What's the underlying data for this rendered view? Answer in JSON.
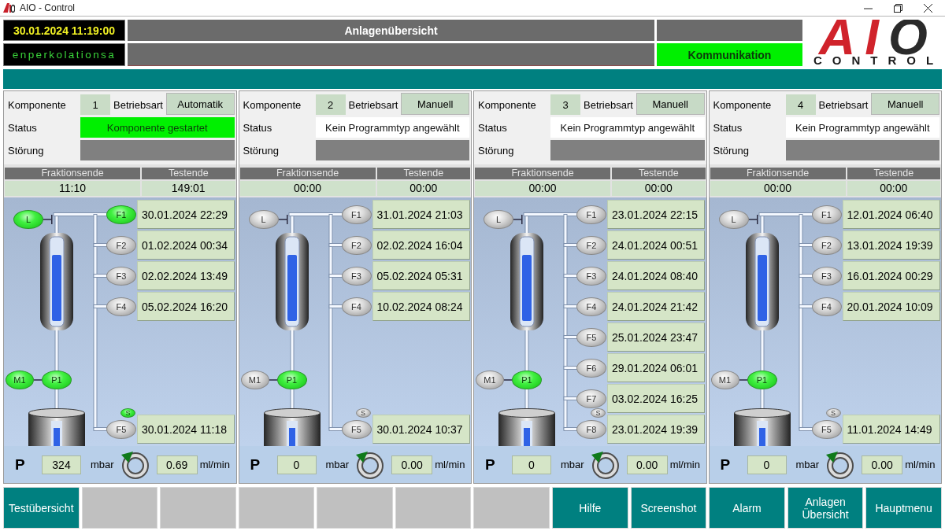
{
  "window": {
    "title": "AIO - Control"
  },
  "header": {
    "datetime": "30.01.2024 11:19:00",
    "title": "Anlagenübersicht",
    "ticker": "enperkolationsa",
    "communication": {
      "label": "Kommunikation",
      "ok": true
    },
    "logo": {
      "mark": "AIO",
      "wordmark": "CONTROL"
    }
  },
  "panels": [
    {
      "component": {
        "label": "Komponente",
        "value": "1"
      },
      "mode": {
        "label": "Betriebsart",
        "value": "Automatik"
      },
      "status": {
        "label": "Status",
        "value": "Komponente gestartet",
        "kind": "running"
      },
      "fault": {
        "label": "Störung",
        "active": false
      },
      "times": [
        {
          "label": "Fraktionsende",
          "value": "11:10"
        },
        {
          "label": "Testende",
          "value": "149:01"
        }
      ],
      "diagram": {
        "inlet": {
          "label": "L",
          "on": true
        },
        "fractions": [
          {
            "label": "F1",
            "date": "30.01.2024 22:29",
            "on": true
          },
          {
            "label": "F2",
            "date": "01.02.2024 00:34",
            "on": false
          },
          {
            "label": "F3",
            "date": "02.02.2024 13:49",
            "on": false
          },
          {
            "label": "F4",
            "date": "05.02.2024 16:20",
            "on": false
          }
        ],
        "outlet": {
          "label": "F5",
          "date": "30.01.2024 11:18",
          "on": false
        },
        "sensor": {
          "label": "S",
          "on": true
        },
        "mixer": {
          "label": "M1",
          "on": true
        },
        "pump": {
          "label": "P1",
          "on": true
        }
      },
      "readings": {
        "pressure": {
          "label": "P",
          "value": "324",
          "unit": "mbar"
        },
        "flow": {
          "value": "0.69",
          "unit": "ml/min"
        }
      }
    },
    {
      "component": {
        "label": "Komponente",
        "value": "2"
      },
      "mode": {
        "label": "Betriebsart",
        "value": "Manuell"
      },
      "status": {
        "label": "Status",
        "value": "Kein Programmtyp angewählt",
        "kind": "idle"
      },
      "fault": {
        "label": "Störung",
        "active": false
      },
      "times": [
        {
          "label": "Fraktionsende",
          "value": "00:00"
        },
        {
          "label": "Testende",
          "value": "00:00"
        }
      ],
      "diagram": {
        "inlet": {
          "label": "L",
          "on": false
        },
        "fractions": [
          {
            "label": "F1",
            "date": "31.01.2024 21:03",
            "on": false
          },
          {
            "label": "F2",
            "date": "02.02.2024 16:04",
            "on": false
          },
          {
            "label": "F3",
            "date": "05.02.2024 05:31",
            "on": false
          },
          {
            "label": "F4",
            "date": "10.02.2024 08:24",
            "on": false
          }
        ],
        "outlet": {
          "label": "F5",
          "date": "30.01.2024 10:37",
          "on": false
        },
        "sensor": {
          "label": "S",
          "on": false
        },
        "mixer": {
          "label": "M1",
          "on": false
        },
        "pump": {
          "label": "P1",
          "on": true
        }
      },
      "readings": {
        "pressure": {
          "label": "P",
          "value": "0",
          "unit": "mbar"
        },
        "flow": {
          "value": "0.00",
          "unit": "ml/min"
        }
      }
    },
    {
      "component": {
        "label": "Komponente",
        "value": "3"
      },
      "mode": {
        "label": "Betriebsart",
        "value": "Manuell"
      },
      "status": {
        "label": "Status",
        "value": "Kein Programmtyp angewählt",
        "kind": "idle"
      },
      "fault": {
        "label": "Störung",
        "active": false
      },
      "times": [
        {
          "label": "Fraktionsende",
          "value": "00:00"
        },
        {
          "label": "Testende",
          "value": "00:00"
        }
      ],
      "diagram": {
        "inlet": {
          "label": "L",
          "on": false
        },
        "fractions": [
          {
            "label": "F1",
            "date": "23.01.2024 22:15",
            "on": false
          },
          {
            "label": "F2",
            "date": "24.01.2024 00:51",
            "on": false
          },
          {
            "label": "F3",
            "date": "24.01.2024 08:40",
            "on": false
          },
          {
            "label": "F4",
            "date": "24.01.2024 21:42",
            "on": false
          },
          {
            "label": "F5",
            "date": "25.01.2024 23:47",
            "on": false
          },
          {
            "label": "F6",
            "date": "29.01.2024 06:01",
            "on": false
          },
          {
            "label": "F7",
            "date": "03.02.2024 16:25",
            "on": false
          }
        ],
        "outlet": {
          "label": "F8",
          "date": "23.01.2024 19:39",
          "on": false
        },
        "sensor": {
          "label": "S",
          "on": false
        },
        "mixer": {
          "label": "M1",
          "on": false
        },
        "pump": {
          "label": "P1",
          "on": true
        }
      },
      "readings": {
        "pressure": {
          "label": "P",
          "value": "0",
          "unit": "mbar"
        },
        "flow": {
          "value": "0.00",
          "unit": "ml/min"
        }
      }
    },
    {
      "component": {
        "label": "Komponente",
        "value": "4"
      },
      "mode": {
        "label": "Betriebsart",
        "value": "Manuell"
      },
      "status": {
        "label": "Status",
        "value": "Kein Programmtyp angewählt",
        "kind": "idle"
      },
      "fault": {
        "label": "Störung",
        "active": false
      },
      "times": [
        {
          "label": "Fraktionsende",
          "value": "00:00"
        },
        {
          "label": "Testende",
          "value": "00:00"
        }
      ],
      "diagram": {
        "inlet": {
          "label": "L",
          "on": false
        },
        "fractions": [
          {
            "label": "F1",
            "date": "12.01.2024 06:40",
            "on": false
          },
          {
            "label": "F2",
            "date": "13.01.2024 19:39",
            "on": false
          },
          {
            "label": "F3",
            "date": "16.01.2024 00:29",
            "on": false
          },
          {
            "label": "F4",
            "date": "20.01.2024 10:09",
            "on": false
          }
        ],
        "outlet": {
          "label": "F5",
          "date": "11.01.2024 14:49",
          "on": false
        },
        "sensor": {
          "label": "S",
          "on": false
        },
        "mixer": {
          "label": "M1",
          "on": false
        },
        "pump": {
          "label": "P1",
          "on": true
        }
      },
      "readings": {
        "pressure": {
          "label": "P",
          "value": "0",
          "unit": "mbar"
        },
        "flow": {
          "value": "0.00",
          "unit": "ml/min"
        }
      }
    }
  ],
  "footer": {
    "buttons": [
      {
        "kind": "command",
        "label": "Testübersicht"
      },
      {
        "kind": "blank"
      },
      {
        "kind": "blank"
      },
      {
        "kind": "blank"
      },
      {
        "kind": "blank"
      },
      {
        "kind": "blank"
      },
      {
        "kind": "blank"
      },
      {
        "kind": "command",
        "label": "Hilfe"
      },
      {
        "kind": "command",
        "label": "Screenshot"
      },
      {
        "kind": "command",
        "label": "Alarm"
      },
      {
        "kind": "command",
        "label": "Anlagen Übersicht"
      },
      {
        "kind": "command",
        "label": "Hauptmenu"
      }
    ]
  }
}
